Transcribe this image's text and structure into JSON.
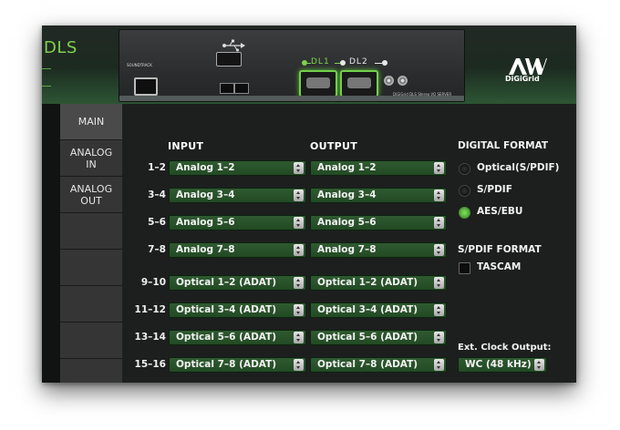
{
  "app": {
    "title_fragment": "DLS"
  },
  "device": {
    "dl1_label": "DL1",
    "dl2_label": "DL2",
    "brand": "SOUNDTRACK",
    "caption": "DiGiGrid DLS  Stereo I/O SERVER"
  },
  "logo": {
    "text": "DiGiGrid"
  },
  "sidebar": {
    "tabs": [
      {
        "line1": "MAIN",
        "line2": ""
      },
      {
        "line1": "ANALOG",
        "line2": "IN"
      },
      {
        "line1": "ANALOG",
        "line2": "OUT"
      },
      {
        "line1": "",
        "line2": ""
      },
      {
        "line1": "",
        "line2": ""
      },
      {
        "line1": "",
        "line2": ""
      },
      {
        "line1": "",
        "line2": ""
      },
      {
        "line1": "",
        "line2": ""
      }
    ]
  },
  "routing": {
    "input_header": "INPUT",
    "output_header": "OUTPUT",
    "rows": [
      {
        "label": "1–2",
        "input": "Analog 1–2",
        "output": "Analog 1–2"
      },
      {
        "label": "3–4",
        "input": "Analog 3–4",
        "output": "Analog 3–4"
      },
      {
        "label": "5–6",
        "input": "Analog 5–6",
        "output": "Analog 5–6"
      },
      {
        "label": "7–8",
        "input": "Analog 7–8",
        "output": "Analog 7–8"
      },
      {
        "label": "9–10",
        "input": "Optical 1–2 (ADAT)",
        "output": "Optical 1–2 (ADAT)"
      },
      {
        "label": "11–12",
        "input": "Optical 3–4 (ADAT)",
        "output": "Optical 3–4 (ADAT)"
      },
      {
        "label": "13–14",
        "input": "Optical 5–6 (ADAT)",
        "output": "Optical 5–6 (ADAT)"
      },
      {
        "label": "15–16",
        "input": "Optical 7–8 (ADAT)",
        "output": "Optical 7–8 (ADAT)"
      }
    ]
  },
  "digital_format": {
    "title": "DIGITAL FORMAT",
    "options": [
      {
        "label": "Optical(S/PDIF)",
        "selected": false
      },
      {
        "label": "S/PDIF",
        "selected": false
      },
      {
        "label": "AES/EBU",
        "selected": true
      }
    ]
  },
  "spdif_format": {
    "title": "S/PDIF FORMAT",
    "checkbox_label": "TASCAM",
    "checked": false
  },
  "clock": {
    "label": "Ext. Clock Output:",
    "value": "WC (48 kHz)"
  },
  "colors": {
    "accent_green": "#7fd14f",
    "select_green": "#2f5a30",
    "panel_bg": "#1d1f1e",
    "sidebar_bg": "#353536"
  }
}
